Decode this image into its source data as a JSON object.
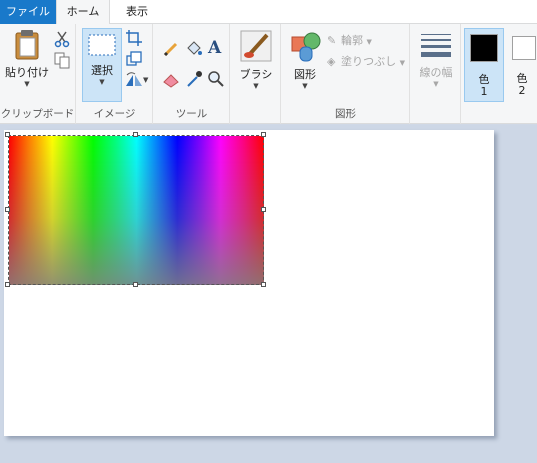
{
  "tabs": {
    "file": "ファイル",
    "home": "ホーム",
    "view": "表示"
  },
  "clipboard": {
    "paste": "貼り付け",
    "group": "クリップボード"
  },
  "image": {
    "select": "選択",
    "group": "イメージ"
  },
  "tools": {
    "group": "ツール"
  },
  "brush": {
    "label": "ブラシ"
  },
  "shapes": {
    "shapes": "図形",
    "outline": "輪郭",
    "fill": "塗りつぶし",
    "group": "図形"
  },
  "line_width": {
    "label": "線の幅"
  },
  "colors": {
    "color1_label": "色",
    "color1_num": "1",
    "color2_label": "色",
    "color2_num": "2",
    "color1_value": "#000000",
    "color2_value": "#ffffff"
  }
}
